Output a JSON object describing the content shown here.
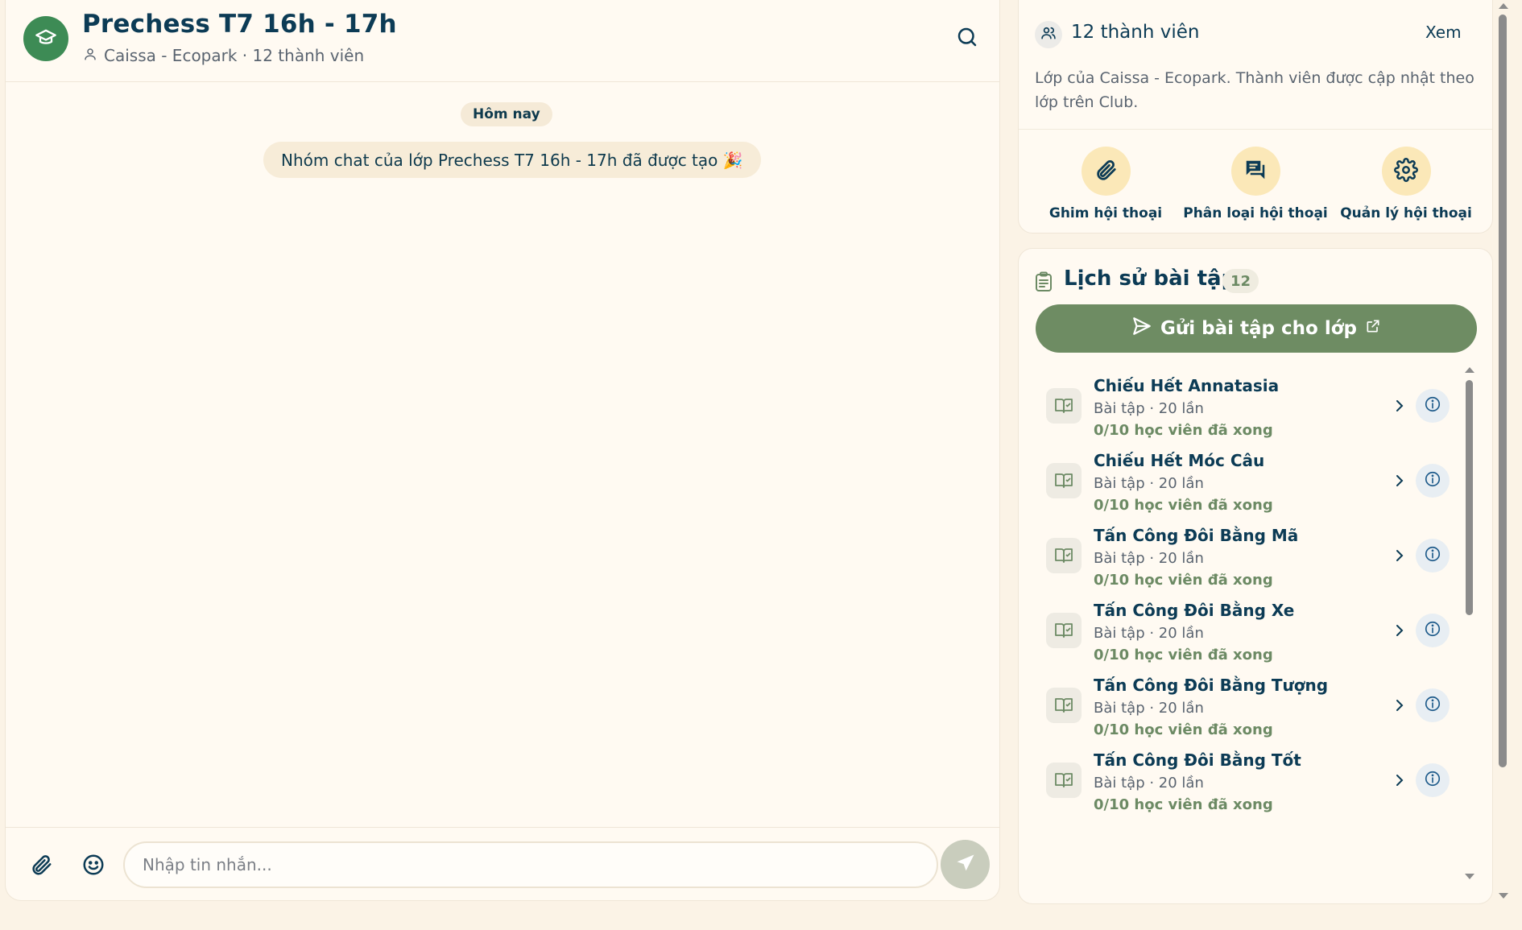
{
  "chat": {
    "title": "Prechess T7 16h - 17h",
    "subtitle": "Caissa - Ecopark · 12 thành viên",
    "date_label": "Hôm nay",
    "system_message": "Nhóm chat của lớp Prechess T7 16h - 17h đã được tạo 🎉",
    "input_placeholder": "Nhập tin nhắn...",
    "input_value": ""
  },
  "members": {
    "title": "12 thành viên",
    "view_label": "Xem",
    "description": "Lớp của Caissa - Ecopark. Thành viên được cập nhật theo lớp trên Club."
  },
  "actions": [
    {
      "label": "Ghim hội thoại",
      "icon": "paperclip-icon"
    },
    {
      "label": "Phân loại hội thoại",
      "icon": "chat-bubbles-icon"
    },
    {
      "label": "Quản lý hội thoại",
      "icon": "gear-icon"
    }
  ],
  "homework": {
    "title": "Lịch sử bài tập",
    "count": "12",
    "send_label": "Gửi bài tập cho lớp",
    "items": [
      {
        "name": "Chiếu Hết Annatasia",
        "meta": "Bài tập · 20 lần",
        "progress": "0/10 học viên đã xong"
      },
      {
        "name": "Chiếu Hết Móc Câu",
        "meta": "Bài tập · 20 lần",
        "progress": "0/10 học viên đã xong"
      },
      {
        "name": "Tấn Công Đôi Bằng Mã",
        "meta": "Bài tập · 20 lần",
        "progress": "0/10 học viên đã xong"
      },
      {
        "name": "Tấn Công Đôi Bằng Xe",
        "meta": "Bài tập · 20 lần",
        "progress": "0/10 học viên đã xong"
      },
      {
        "name": "Tấn Công Đôi Bằng Tượng",
        "meta": "Bài tập · 20 lần",
        "progress": "0/10 học viên đã xong"
      },
      {
        "name": "Tấn Công Đôi Bằng Tốt",
        "meta": "Bài tập · 20 lần",
        "progress": "0/10 học viên đã xong"
      }
    ]
  },
  "colors": {
    "accent_green": "#6e8c63",
    "avatar_green": "#3d8b55",
    "title_navy": "#0c3b55",
    "action_yellow": "#fbe8b8",
    "background": "#fbf3e6"
  }
}
